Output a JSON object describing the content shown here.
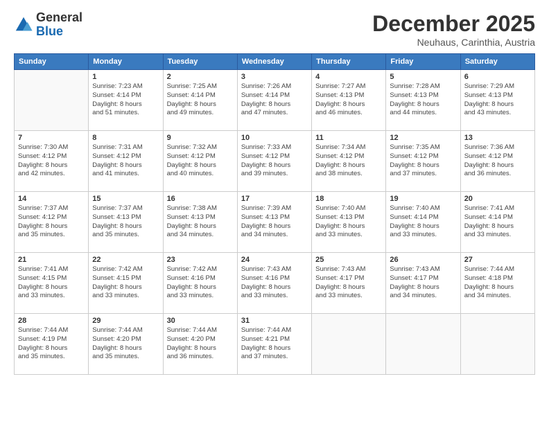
{
  "logo": {
    "general": "General",
    "blue": "Blue"
  },
  "title": "December 2025",
  "subtitle": "Neuhaus, Carinthia, Austria",
  "days_header": [
    "Sunday",
    "Monday",
    "Tuesday",
    "Wednesday",
    "Thursday",
    "Friday",
    "Saturday"
  ],
  "weeks": [
    [
      {
        "day": "",
        "info": ""
      },
      {
        "day": "1",
        "info": "Sunrise: 7:23 AM\nSunset: 4:14 PM\nDaylight: 8 hours\nand 51 minutes."
      },
      {
        "day": "2",
        "info": "Sunrise: 7:25 AM\nSunset: 4:14 PM\nDaylight: 8 hours\nand 49 minutes."
      },
      {
        "day": "3",
        "info": "Sunrise: 7:26 AM\nSunset: 4:14 PM\nDaylight: 8 hours\nand 47 minutes."
      },
      {
        "day": "4",
        "info": "Sunrise: 7:27 AM\nSunset: 4:13 PM\nDaylight: 8 hours\nand 46 minutes."
      },
      {
        "day": "5",
        "info": "Sunrise: 7:28 AM\nSunset: 4:13 PM\nDaylight: 8 hours\nand 44 minutes."
      },
      {
        "day": "6",
        "info": "Sunrise: 7:29 AM\nSunset: 4:13 PM\nDaylight: 8 hours\nand 43 minutes."
      }
    ],
    [
      {
        "day": "7",
        "info": "Sunrise: 7:30 AM\nSunset: 4:12 PM\nDaylight: 8 hours\nand 42 minutes."
      },
      {
        "day": "8",
        "info": "Sunrise: 7:31 AM\nSunset: 4:12 PM\nDaylight: 8 hours\nand 41 minutes."
      },
      {
        "day": "9",
        "info": "Sunrise: 7:32 AM\nSunset: 4:12 PM\nDaylight: 8 hours\nand 40 minutes."
      },
      {
        "day": "10",
        "info": "Sunrise: 7:33 AM\nSunset: 4:12 PM\nDaylight: 8 hours\nand 39 minutes."
      },
      {
        "day": "11",
        "info": "Sunrise: 7:34 AM\nSunset: 4:12 PM\nDaylight: 8 hours\nand 38 minutes."
      },
      {
        "day": "12",
        "info": "Sunrise: 7:35 AM\nSunset: 4:12 PM\nDaylight: 8 hours\nand 37 minutes."
      },
      {
        "day": "13",
        "info": "Sunrise: 7:36 AM\nSunset: 4:12 PM\nDaylight: 8 hours\nand 36 minutes."
      }
    ],
    [
      {
        "day": "14",
        "info": "Sunrise: 7:37 AM\nSunset: 4:12 PM\nDaylight: 8 hours\nand 35 minutes."
      },
      {
        "day": "15",
        "info": "Sunrise: 7:37 AM\nSunset: 4:13 PM\nDaylight: 8 hours\nand 35 minutes."
      },
      {
        "day": "16",
        "info": "Sunrise: 7:38 AM\nSunset: 4:13 PM\nDaylight: 8 hours\nand 34 minutes."
      },
      {
        "day": "17",
        "info": "Sunrise: 7:39 AM\nSunset: 4:13 PM\nDaylight: 8 hours\nand 34 minutes."
      },
      {
        "day": "18",
        "info": "Sunrise: 7:40 AM\nSunset: 4:13 PM\nDaylight: 8 hours\nand 33 minutes."
      },
      {
        "day": "19",
        "info": "Sunrise: 7:40 AM\nSunset: 4:14 PM\nDaylight: 8 hours\nand 33 minutes."
      },
      {
        "day": "20",
        "info": "Sunrise: 7:41 AM\nSunset: 4:14 PM\nDaylight: 8 hours\nand 33 minutes."
      }
    ],
    [
      {
        "day": "21",
        "info": "Sunrise: 7:41 AM\nSunset: 4:15 PM\nDaylight: 8 hours\nand 33 minutes."
      },
      {
        "day": "22",
        "info": "Sunrise: 7:42 AM\nSunset: 4:15 PM\nDaylight: 8 hours\nand 33 minutes."
      },
      {
        "day": "23",
        "info": "Sunrise: 7:42 AM\nSunset: 4:16 PM\nDaylight: 8 hours\nand 33 minutes."
      },
      {
        "day": "24",
        "info": "Sunrise: 7:43 AM\nSunset: 4:16 PM\nDaylight: 8 hours\nand 33 minutes."
      },
      {
        "day": "25",
        "info": "Sunrise: 7:43 AM\nSunset: 4:17 PM\nDaylight: 8 hours\nand 33 minutes."
      },
      {
        "day": "26",
        "info": "Sunrise: 7:43 AM\nSunset: 4:17 PM\nDaylight: 8 hours\nand 34 minutes."
      },
      {
        "day": "27",
        "info": "Sunrise: 7:44 AM\nSunset: 4:18 PM\nDaylight: 8 hours\nand 34 minutes."
      }
    ],
    [
      {
        "day": "28",
        "info": "Sunrise: 7:44 AM\nSunset: 4:19 PM\nDaylight: 8 hours\nand 35 minutes."
      },
      {
        "day": "29",
        "info": "Sunrise: 7:44 AM\nSunset: 4:20 PM\nDaylight: 8 hours\nand 35 minutes."
      },
      {
        "day": "30",
        "info": "Sunrise: 7:44 AM\nSunset: 4:20 PM\nDaylight: 8 hours\nand 36 minutes."
      },
      {
        "day": "31",
        "info": "Sunrise: 7:44 AM\nSunset: 4:21 PM\nDaylight: 8 hours\nand 37 minutes."
      },
      {
        "day": "",
        "info": ""
      },
      {
        "day": "",
        "info": ""
      },
      {
        "day": "",
        "info": ""
      }
    ]
  ]
}
